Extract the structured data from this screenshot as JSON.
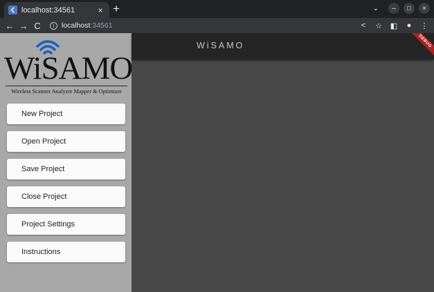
{
  "browser": {
    "tab_title": "localhost:34561",
    "tab_close": "×",
    "new_tab": "+",
    "url_host": "localhost",
    "url_port": ":34561",
    "back": "←",
    "forward": "→",
    "reload": "C",
    "window_controls": {
      "minimize": "–",
      "maximize": "□",
      "close": "×"
    }
  },
  "app": {
    "logo": {
      "word": "WiSAMO",
      "subtitle": "Wireless Scanner Analyzer Mapper & Optimizer"
    },
    "appbar_title": "WiSAMO",
    "debug_banner": "DEBUG",
    "menu": [
      {
        "label": "New Project"
      },
      {
        "label": "Open Project"
      },
      {
        "label": "Save Project"
      },
      {
        "label": "Close Project"
      },
      {
        "label": "Project Settings"
      },
      {
        "label": "Instructions"
      }
    ]
  },
  "colors": {
    "drawer_bg": "#a8a8a8",
    "appbar_bg": "#252525",
    "canvas_bg": "#484848",
    "wifi_blue": "#1f5fbf"
  },
  "icons": [
    "favicon-icon",
    "info-icon",
    "share-icon",
    "star-icon",
    "sidepanel-icon",
    "profile-icon",
    "more-icon",
    "wifi-icon"
  ]
}
